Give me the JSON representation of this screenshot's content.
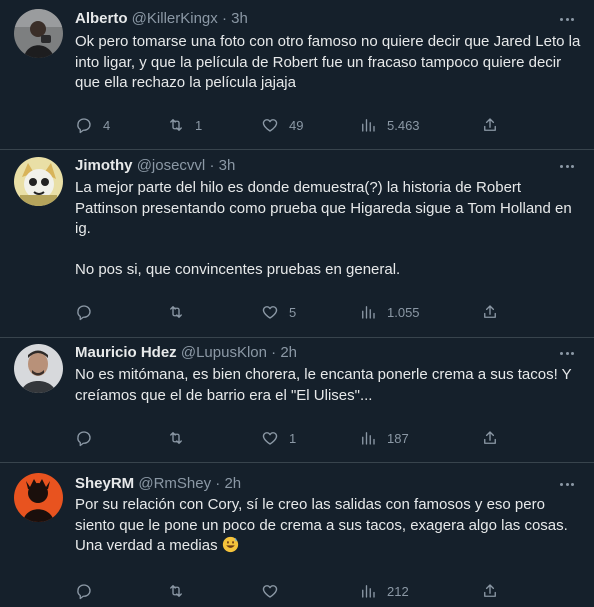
{
  "tweets": [
    {
      "name": "Alberto",
      "handle": "@KillerKingx",
      "dot": "·",
      "time": "3h",
      "paragraphs": [
        "Ok pero tomarse una foto con otro famoso no quiere decir que Jared Leto la into ligar, y que la película de Robert fue un fracaso tampoco quiere decir que ella rechazo la película jajaja"
      ],
      "replies": "4",
      "retweets": "1",
      "likes": "49",
      "views": "5.463"
    },
    {
      "name": "Jimothy",
      "handle": "@josecvvl",
      "dot": "·",
      "time": "3h",
      "paragraphs": [
        "La mejor parte del hilo es donde demuestra(?) la historia de Robert Pattinson presentando como prueba que Higareda sigue a Tom Holland en ig.",
        "No pos si, que convincentes pruebas en general."
      ],
      "replies": "",
      "retweets": "",
      "likes": "5",
      "views": "1.055"
    },
    {
      "name": "Mauricio Hdez",
      "handle": "@LupusKlon",
      "dot": "·",
      "time": "2h",
      "paragraphs": [
        "No es mitómana, es bien chorera, le encanta ponerle crema a sus tacos! Y creíamos que el de barrio era el \"El Ulises\"..."
      ],
      "replies": "",
      "retweets": "",
      "likes": "1",
      "views": "187"
    },
    {
      "name": "SheyRM",
      "handle": "@RmShey",
      "dot": "·",
      "time": "2h",
      "paragraphs": [
        "Por su relación con Cory, sí le creo las salidas con famosos y eso pero siento que le pone un poco de crema a sus tacos, exagera algo las cosas. Una verdad a medias"
      ],
      "emoji": "grinning-sweat-emoji",
      "replies": "",
      "retweets": "",
      "likes": "",
      "views": "212"
    }
  ],
  "icons": {
    "reply": "reply-icon",
    "retweet": "retweet-icon",
    "like": "heart-icon",
    "views": "views-chart-icon",
    "share": "share-icon",
    "more": "more-icon"
  },
  "colors": {
    "background": "#15202b",
    "divider": "#38444d",
    "primary_text": "#e7e9ea",
    "secondary_text": "#8b98a5"
  }
}
